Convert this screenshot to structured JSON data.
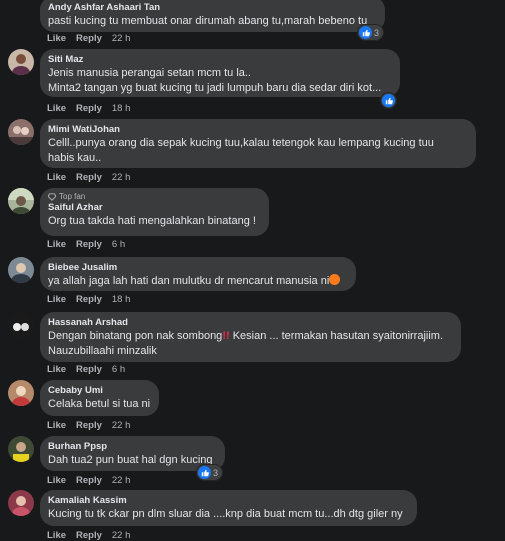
{
  "actions": {
    "like": "Like",
    "reply": "Reply"
  },
  "comments": [
    {
      "author": "Andy Ashfar Ashaari Tan",
      "lines": [
        "pasti kucing tu membuat onar dirumah abang tu,marah bebeno tu"
      ],
      "time": "22 h",
      "reactions": "3"
    },
    {
      "author": "Siti Maz",
      "lines": [
        "Jenis manusia perangai setan mcm tu la..",
        "Minta2 tangan yg buat kucing tu jadi lumpuh baru dia sedar diri kot..."
      ],
      "time": "18 h",
      "reactions": ""
    },
    {
      "author": "Mimi WatiJohan",
      "lines": [
        "Celll..punya orang dia sepak kucing tuu,kalau tetengok kau lempang kucing tuu",
        "habis kau.."
      ],
      "time": "22 h"
    },
    {
      "author": "Saiful Azhar",
      "badge": "Top fan",
      "lines": [
        "Org tua takda hati mengalahkan binatang !"
      ],
      "time": "6 h"
    },
    {
      "author": "Biebee Jusalim",
      "lines": [
        "ya allah jaga lah hati dan mulutku dr mencarut manusia ni"
      ],
      "time": "18 h"
    },
    {
      "author": "Hassanah Arshad",
      "lines": [
        "Dengan binatang pon nak sombong",
        " Kesian ... termakan hasutan syaitonirrajiim.",
        "Nauzubillaahi minzalik"
      ],
      "time": "6 h"
    },
    {
      "author": "Cebaby Umi",
      "lines": [
        "Celaka betul si tua ni"
      ],
      "time": "22 h"
    },
    {
      "author": "Burhan Ppsp",
      "lines": [
        "Dah tua2 pun buat hal dgn kucing"
      ],
      "time": "22 h",
      "reactions": "3"
    },
    {
      "author": "Kamaliah Kassim",
      "lines": [
        "Kucing tu tk ckar pn dlm sluar dia ....knp dia buat mcm tu...dh dtg giler ny"
      ],
      "time": "22 h"
    }
  ],
  "colors": {
    "background": "#18191a",
    "bubble": "#3a3b3c",
    "like_blue": "#1877f2",
    "secondary_text": "#b0b3b8"
  }
}
